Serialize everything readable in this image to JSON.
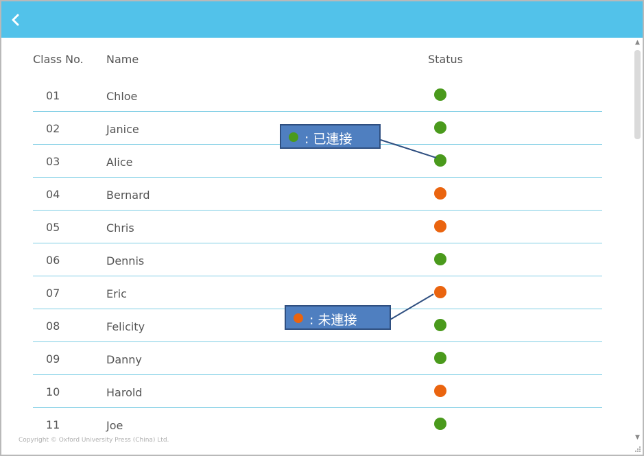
{
  "header": {
    "back_icon": "chevron-left-icon",
    "bg_color": "#52c2ea"
  },
  "table": {
    "columns": {
      "class_no": "Class No.",
      "name": "Name",
      "status": "Status"
    },
    "rows": [
      {
        "no": "01",
        "name": "Chloe",
        "status": "connected"
      },
      {
        "no": "02",
        "name": "Janice",
        "status": "connected"
      },
      {
        "no": "03",
        "name": "Alice",
        "status": "connected"
      },
      {
        "no": "04",
        "name": "Bernard",
        "status": "disconnected"
      },
      {
        "no": "05",
        "name": "Chris",
        "status": "disconnected"
      },
      {
        "no": "06",
        "name": "Dennis",
        "status": "connected"
      },
      {
        "no": "07",
        "name": "Eric",
        "status": "disconnected"
      },
      {
        "no": "08",
        "name": "Felicity",
        "status": "connected"
      },
      {
        "no": "09",
        "name": "Danny",
        "status": "connected"
      },
      {
        "no": "10",
        "name": "Harold",
        "status": "disconnected"
      },
      {
        "no": "11",
        "name": "Joe",
        "status": "connected"
      }
    ]
  },
  "status_colors": {
    "connected": "#4a9a1c",
    "disconnected": "#ea640f"
  },
  "legend": {
    "connected_label": ": 已連接",
    "disconnected_label": ": 未連接"
  },
  "footer": {
    "copyright": "Copyright © Oxford University Press (China) Ltd."
  }
}
